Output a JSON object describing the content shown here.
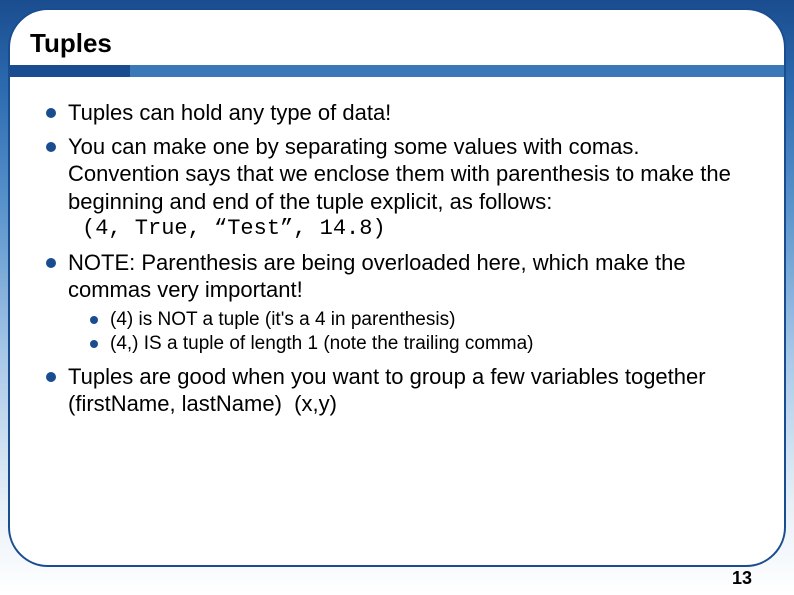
{
  "title": "Tuples",
  "bullets": {
    "b1": "Tuples can hold any type of data!",
    "b2_part1": "You can make one by separating some values with comas. Convention says that we enclose them with parenthesis to make the beginning and end of the tuple explicit, as follows:",
    "b2_code": "(4, True, “Test”, 14.8)",
    "b3": "NOTE: Parenthesis are being overloaded here, which make the commas very important!",
    "b3_sub1": "(4) is NOT a tuple (it's a 4 in parenthesis)",
    "b3_sub2": "(4,) IS a tuple of length 1 (note the trailing comma)",
    "b4": "Tuples are good when you want to group a few variables together (firstName, lastName)  (x,y)"
  },
  "page_number": "13"
}
